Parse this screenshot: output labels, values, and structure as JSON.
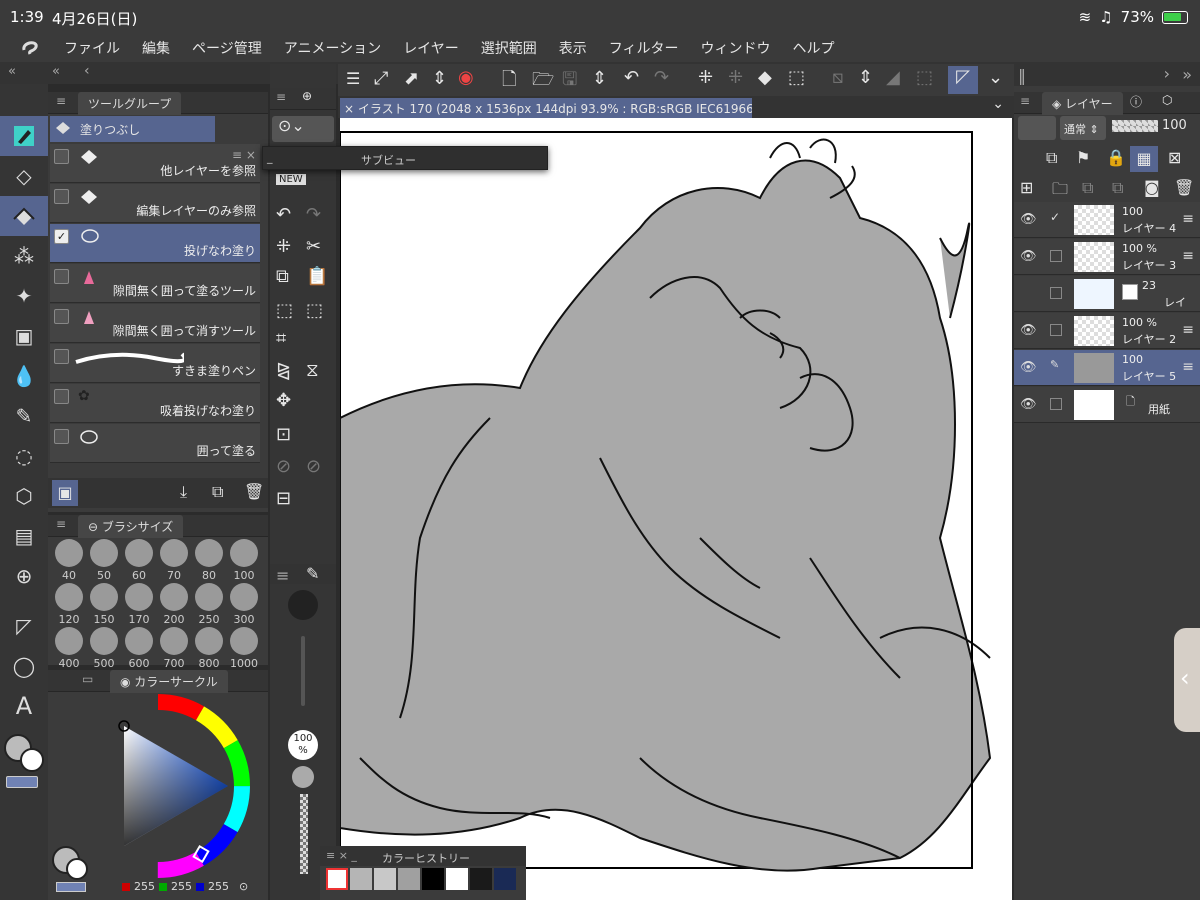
{
  "status": {
    "time": "1:39",
    "date": "4月26日(日)",
    "battery": "73%"
  },
  "menu": [
    "ファイル",
    "編集",
    "ページ管理",
    "アニメーション",
    "レイヤー",
    "選択範囲",
    "表示",
    "フィルター",
    "ウィンドウ",
    "ヘルプ"
  ],
  "subtool": {
    "tab": "ツールグループ",
    "group_title": "塗りつぶし",
    "items": [
      {
        "label": "他レイヤーを参照",
        "checked": false
      },
      {
        "label": "編集レイヤーのみ参照",
        "checked": false
      },
      {
        "label": "投げなわ塗り",
        "checked": true
      },
      {
        "label": "隙間無く囲って塗るツール",
        "checked": false
      },
      {
        "label": "隙間無く囲って消すツール",
        "checked": false
      },
      {
        "label": "すきま塗りペン",
        "checked": false
      },
      {
        "label": "吸着投げなわ塗り",
        "checked": false
      },
      {
        "label": "囲って塗る",
        "checked": false
      }
    ]
  },
  "brushsize": {
    "tab": "ブラシサイズ",
    "sizes": [
      "40",
      "50",
      "60",
      "70",
      "80",
      "100",
      "120",
      "150",
      "170",
      "200",
      "250",
      "300",
      "400",
      "500",
      "600",
      "700",
      "800",
      "1000"
    ]
  },
  "colorcircle": {
    "tab": "カラーサークル",
    "r": "255",
    "g": "255",
    "b": "255"
  },
  "subview": {
    "title": "サブビュー"
  },
  "canvas": {
    "tab_title": "イラスト 170 (2048 x 1536px 144dpi 93.9% : RGB:sRGB IEC61966-2.1)"
  },
  "midcol": {
    "opacity_value": "100",
    "opacity_unit": "%"
  },
  "layers": {
    "tab": "レイヤー",
    "blend_mode": "通常",
    "opacity": "100",
    "rows": [
      {
        "opacity": "100",
        "name": "レイヤー 4",
        "visible": true,
        "selected": false
      },
      {
        "opacity": "100 %",
        "name": "レイヤー 3",
        "visible": true,
        "selected": false
      },
      {
        "opacity": "23",
        "name": "レイ",
        "visible": false,
        "selected": false
      },
      {
        "opacity": "100 %",
        "name": "レイヤー 2",
        "visible": true,
        "selected": false
      },
      {
        "opacity": "100",
        "name": "レイヤー 5",
        "visible": true,
        "selected": true
      },
      {
        "opacity": "",
        "name": "用紙",
        "visible": true,
        "selected": false
      }
    ]
  },
  "colorhistory": {
    "title": "カラーヒストリー",
    "swatches": [
      "#ffffff",
      "#b5b5b5",
      "#c8c8c8",
      "#a0a0a0",
      "#000000",
      "#ffffff",
      "#1a1a1a",
      "#1a2a55"
    ]
  },
  "colors": {
    "accent": "#566590",
    "panel": "#3b3b3b",
    "fill_gray": "#a9a9a9"
  }
}
